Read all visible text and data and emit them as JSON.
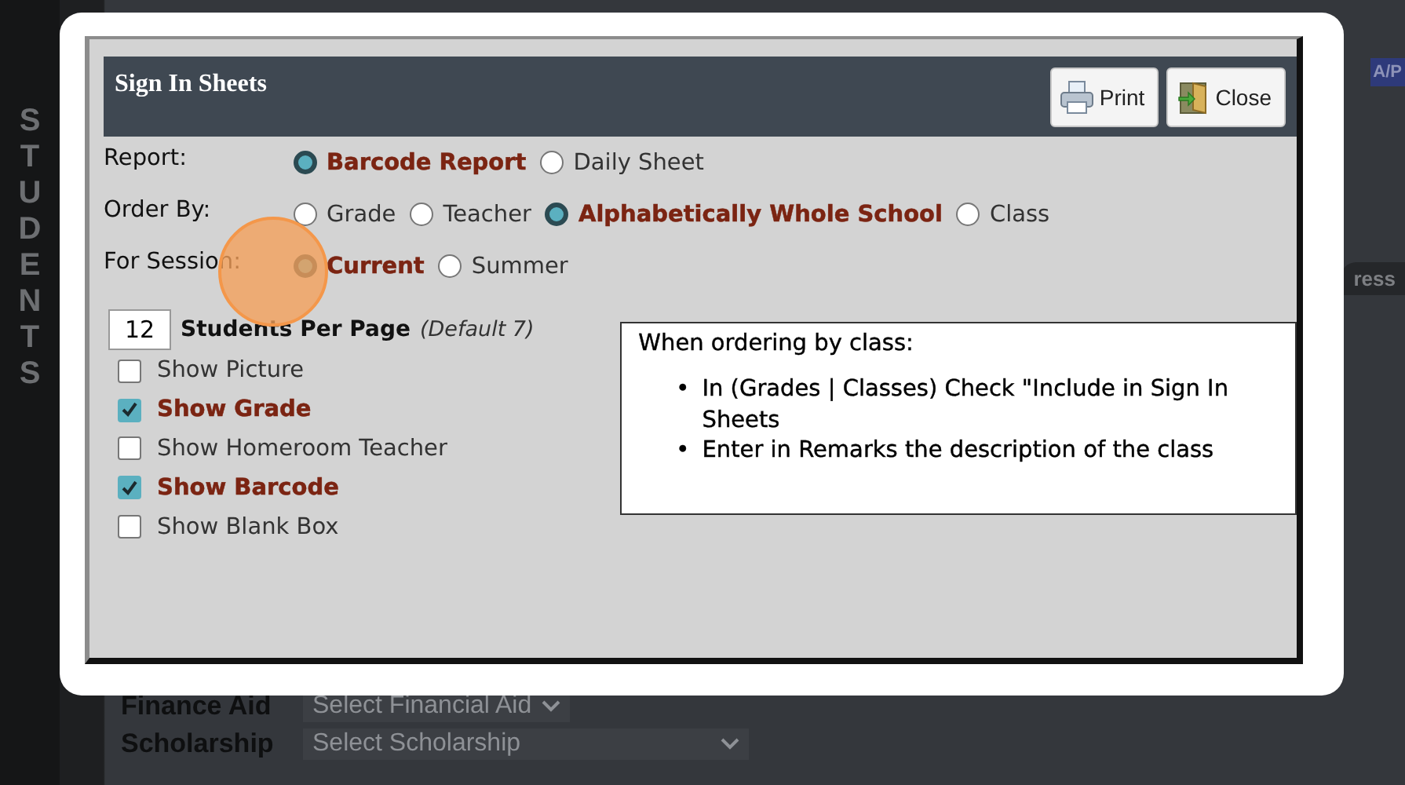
{
  "background": {
    "sidebar_label": "STUDENTS",
    "badge": "A/P",
    "tab": "ress",
    "fields": [
      {
        "label": "Finance Aid",
        "value": "Select Financial Aid"
      },
      {
        "label": "Scholarship",
        "value": "Select Scholarship"
      }
    ]
  },
  "dialog": {
    "title": "Sign In Sheets",
    "buttons": [
      {
        "label": "Print",
        "kind": "print"
      },
      {
        "label": "Close",
        "kind": "close"
      }
    ],
    "option_groups": [
      {
        "label": "Report:",
        "options": [
          {
            "label": "Barcode Report",
            "selected": true
          },
          {
            "label": "Daily Sheet",
            "selected": false
          }
        ]
      },
      {
        "label": "Order By:",
        "options": [
          {
            "label": "Grade",
            "selected": false
          },
          {
            "label": "Teacher",
            "selected": false
          },
          {
            "label": "Alphabetically Whole School",
            "selected": true
          },
          {
            "label": "Class",
            "selected": false
          }
        ]
      },
      {
        "label": "For Session:",
        "options": [
          {
            "label": "Current",
            "selected": true
          },
          {
            "label": "Summer",
            "selected": false
          }
        ]
      }
    ],
    "per_page": {
      "value": "12",
      "label": "Students Per Page",
      "hint": "(Default 7)"
    },
    "checkboxes": [
      {
        "label": "Show Picture",
        "checked": false
      },
      {
        "label": "Show Grade",
        "checked": true
      },
      {
        "label": "Show Homeroom Teacher",
        "checked": false
      },
      {
        "label": "Show Barcode",
        "checked": true
      },
      {
        "label": "Show Blank Box",
        "checked": false
      }
    ],
    "info": {
      "heading": "When ordering by class:",
      "bullet": "•",
      "items": [
        "In (Grades | Classes) Check \"Include in Sign In Sheets",
        "Enter in Remarks the description of the class"
      ]
    }
  }
}
